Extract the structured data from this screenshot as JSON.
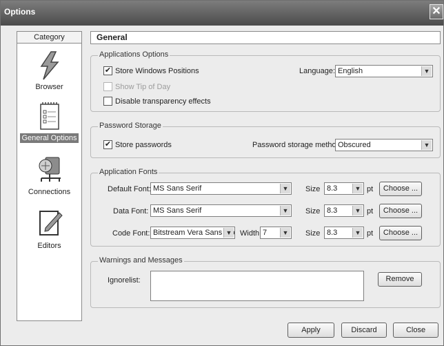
{
  "window": {
    "title": "Options",
    "close_glyph": "✕"
  },
  "sidebar": {
    "header": "Category",
    "items": [
      {
        "label": "Browser",
        "icon": "lightning-icon"
      },
      {
        "label": "General Options",
        "icon": "notepad-icon",
        "selected": true
      },
      {
        "label": "Connections",
        "icon": "network-icon"
      },
      {
        "label": "Editors",
        "icon": "edit-icon"
      }
    ]
  },
  "page": {
    "title": "General"
  },
  "app_options": {
    "legend": "Applications Options",
    "store_windows_positions": {
      "label": "Store Windows Positions",
      "checked": true
    },
    "show_tip_of_day": {
      "label": "Show Tip of Day",
      "checked": false,
      "disabled": true
    },
    "disable_transparency": {
      "label": "Disable transparency effects",
      "checked": false
    },
    "language_label": "Language:",
    "language_value": "English"
  },
  "password_storage": {
    "legend": "Password Storage",
    "store_passwords": {
      "label": "Store passwords",
      "checked": true
    },
    "method_label": "Password storage method:",
    "method_value": "Obscured"
  },
  "fonts": {
    "legend": "Application Fonts",
    "default": {
      "label": "Default Font:",
      "font": "MS Sans Serif",
      "size_label": "Size",
      "size": "8.3",
      "unit": "pt",
      "choose": "Choose ..."
    },
    "data": {
      "label": "Data Font:",
      "font": "MS Sans Serif",
      "size_label": "Size",
      "size": "8.3",
      "unit": "pt",
      "choose": "Choose ..."
    },
    "code": {
      "label": "Code Font:",
      "font": "Bitstream Vera Sans Mo",
      "width_label": "Width:",
      "width": "7",
      "size_label": "Size",
      "size": "8.3",
      "unit": "pt",
      "choose": "Choose ..."
    }
  },
  "warnings": {
    "legend": "Warnings and Messages",
    "ignorelist_label": "Ignorelist:",
    "remove": "Remove"
  },
  "footer": {
    "apply": "Apply",
    "discard": "Discard",
    "close": "Close"
  }
}
